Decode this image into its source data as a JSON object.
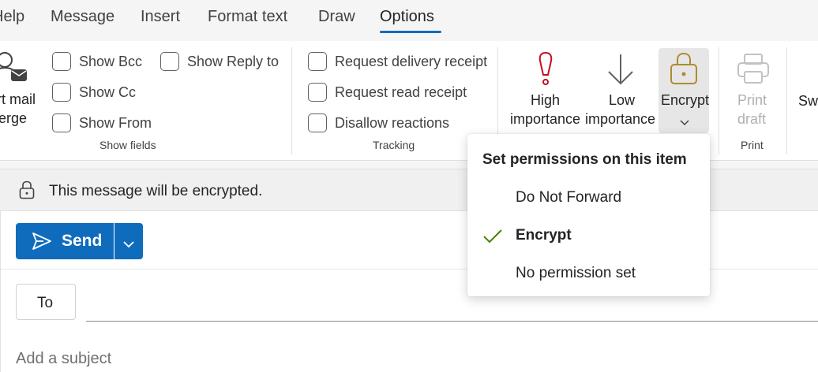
{
  "tabs": [
    {
      "label": "Help"
    },
    {
      "label": "Message"
    },
    {
      "label": "Insert"
    },
    {
      "label": "Format text"
    },
    {
      "label": "Draw"
    },
    {
      "label": "Options"
    }
  ],
  "active_tab": "Options",
  "ribbon": {
    "mail_merge": {
      "line1": "Start mail",
      "line2": "merge",
      "visible_line1": "rt mail",
      "visible_line2": "erge",
      "icon": "mail-merge-icon"
    },
    "show_fields": {
      "label": "Show fields",
      "items": [
        {
          "label": "Show Bcc",
          "checked": false
        },
        {
          "label": "Show Cc",
          "checked": false
        },
        {
          "label": "Show From",
          "checked": false
        },
        {
          "label": "Show Reply to",
          "checked": false
        }
      ]
    },
    "tracking": {
      "label": "Tracking",
      "items": [
        {
          "label": "Request delivery receipt",
          "checked": false
        },
        {
          "label": "Request read receipt",
          "checked": false
        },
        {
          "label": "Disallow reactions",
          "checked": false
        }
      ]
    },
    "high_importance": {
      "line1": "High",
      "line2": "importance",
      "icon": "exclamation-icon",
      "color": "#c50f1f"
    },
    "low_importance": {
      "line1": "Low",
      "line2": "importance",
      "icon": "arrow-down-icon"
    },
    "encrypt": {
      "label": "Encrypt",
      "icon": "lock-icon",
      "color": "#b08a2e"
    },
    "print_group": {
      "label": "Print",
      "print_draft_line1": "Print",
      "print_draft_line2": "draft",
      "icon": "printer-icon"
    },
    "switch_partial": "Swi"
  },
  "banner": {
    "text": "This message will be encrypted.",
    "icon": "lock-icon"
  },
  "compose": {
    "send_label": "Send",
    "to_label": "To",
    "subject_placeholder": "Add a subject",
    "accent": "#0f6cbd"
  },
  "permissions_menu": {
    "title": "Set permissions on this item",
    "items": [
      {
        "label": "Do Not Forward",
        "selected": false
      },
      {
        "label": "Encrypt",
        "selected": true
      },
      {
        "label": "No permission set",
        "selected": false
      }
    ],
    "check_color": "#498205"
  }
}
